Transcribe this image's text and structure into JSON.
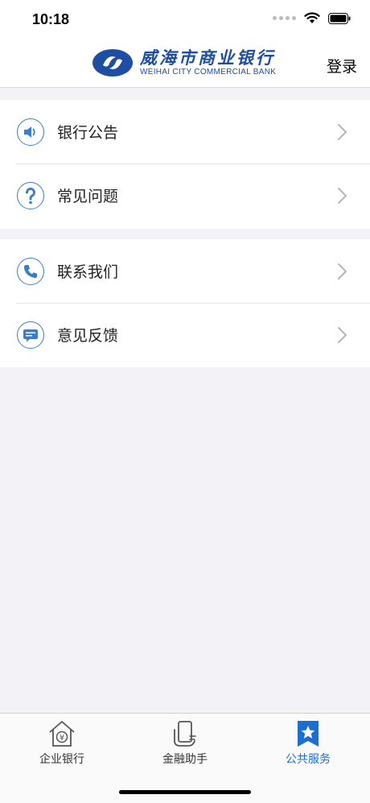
{
  "status_bar": {
    "time": "10:18"
  },
  "header": {
    "logo_cn": "威海市商业银行",
    "logo_en": "WEIHAI CITY COMMERCIAL BANK",
    "login_label": "登录"
  },
  "menu_groups": [
    {
      "items": [
        {
          "label": "银行公告",
          "icon": "speaker-icon"
        },
        {
          "label": "常见问题",
          "icon": "question-icon"
        }
      ]
    },
    {
      "items": [
        {
          "label": "联系我们",
          "icon": "phone-icon"
        },
        {
          "label": "意见反馈",
          "icon": "feedback-icon"
        }
      ]
    }
  ],
  "tabbar": {
    "tabs": [
      {
        "label": "企业银行",
        "icon": "house-yuan-icon",
        "active": false
      },
      {
        "label": "金融助手",
        "icon": "phone-hand-icon",
        "active": false
      },
      {
        "label": "公共服务",
        "icon": "star-bookmark-icon",
        "active": true
      }
    ]
  },
  "colors": {
    "accent": "#1a6fd0",
    "brand_blue": "#1d4ea1",
    "icon_blue": "#3a7ec9"
  }
}
